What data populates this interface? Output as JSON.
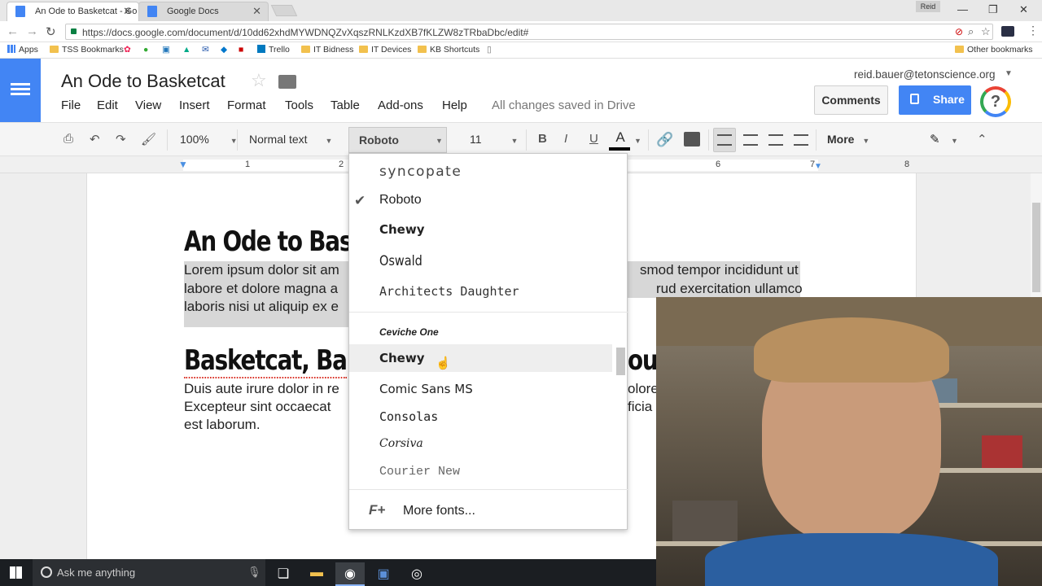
{
  "browser": {
    "tabs": [
      {
        "title": "An Ode to Basketcat - Go",
        "active": true
      },
      {
        "title": "Google Docs",
        "active": false
      }
    ],
    "profile_name": "Reid",
    "url": "https://docs.google.com/document/d/10dd62xhdMYWDNQZvXqszRNLKzdXB7fKLZW8zTRbaDbc/edit#"
  },
  "bookmarks": {
    "items": [
      "Apps",
      "TSS Bookmarks",
      "Trello",
      "IT Bidness",
      "IT Devices",
      "KB Shortcuts"
    ],
    "other": "Other bookmarks"
  },
  "doc": {
    "title": "An Ode to Basketcat",
    "menus": [
      "File",
      "Edit",
      "View",
      "Insert",
      "Format",
      "Tools",
      "Table",
      "Add-ons",
      "Help"
    ],
    "save_status": "All changes saved in Drive",
    "user_email": "reid.bauer@tetonscience.org",
    "comments_label": "Comments",
    "share_label": "Share",
    "help_label": "?"
  },
  "toolbar": {
    "zoom": "100%",
    "style": "Normal text",
    "font": "Roboto",
    "size": "11",
    "bold": "B",
    "italic": "I",
    "underline": "U",
    "textcolor": "A",
    "more": "More"
  },
  "ruler": {
    "marks": [
      "1",
      "2",
      "6",
      "7",
      "8"
    ]
  },
  "content": {
    "heading1": "An Ode to Bas",
    "para1_line1_left": "Lorem ipsum dolor sit am",
    "para1_line1_right": "smod tempor incididunt ut",
    "para1_line2_left": "labore et dolore magna a",
    "para1_line2_right": "rud exercitation ullamco",
    "para1_line3_left": "laboris nisi ut aliquip ex e",
    "heading2_left": "Basketcat, Ba",
    "heading2_right": "ou",
    "para2_line1_left": "Duis aute irure dolor in re",
    "para2_line1_right": "olore",
    "para2_line2_left": "Excepteur sint occaecat",
    "para2_line2_right": "ficia",
    "para2_line3_left": "est laborum."
  },
  "font_menu": {
    "recent": [
      "Syncopate",
      "Roboto",
      "Chewy",
      "Oswald",
      "Architects Daughter"
    ],
    "all": [
      "Ceviche One",
      "Chewy",
      "Comic Sans MS",
      "Consolas",
      "Corsiva",
      "Courier New"
    ],
    "more_fonts": "More fonts...",
    "more_fonts_icon": "F+",
    "selected": "Roboto",
    "hovered": "Chewy"
  },
  "taskbar": {
    "search_placeholder": "Ask me anything"
  },
  "colors": {
    "docs_blue": "#4285f4",
    "selection": "#d7d7d7",
    "taskbar": "#1b1e22"
  }
}
